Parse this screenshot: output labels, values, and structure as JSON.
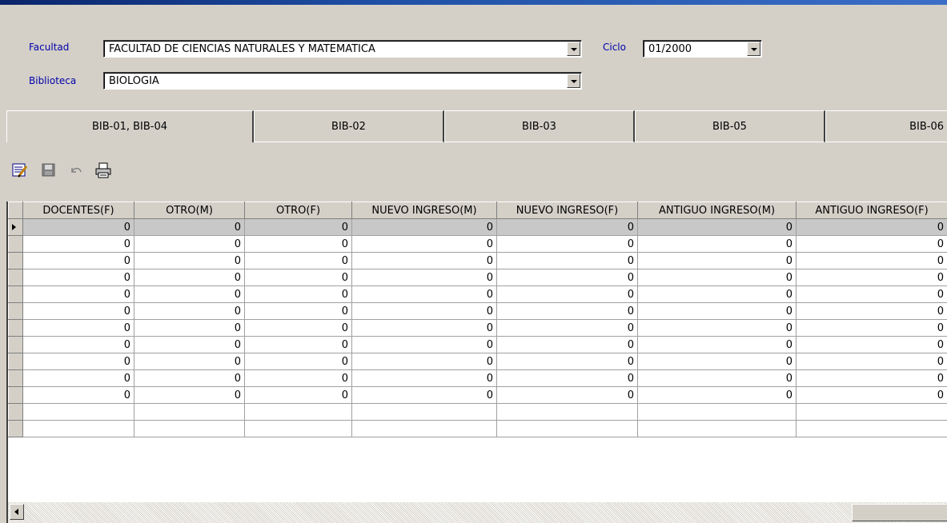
{
  "filters": {
    "facultad_label": "Facultad",
    "facultad_value": "FACULTAD DE CIENCIAS  NATURALES  Y MATEMATICA",
    "biblioteca_label": "Biblioteca",
    "biblioteca_value": "BIOLOGIA",
    "ciclo_label": "Ciclo",
    "ciclo_value": "01/2000"
  },
  "tabs": [
    {
      "label": "BIB-01, BIB-04",
      "active": true
    },
    {
      "label": "BIB-02",
      "active": false
    },
    {
      "label": "BIB-03",
      "active": false
    },
    {
      "label": "BIB-05",
      "active": false
    },
    {
      "label": "BIB-06",
      "active": false
    }
  ],
  "toolbar": {
    "icons": [
      "edit-icon",
      "save-icon",
      "undo-icon",
      "print-icon"
    ]
  },
  "grid": {
    "columns": [
      "DOCENTES(F)",
      "OTRO(M)",
      "OTRO(F)",
      "NUEVO INGRESO(M)",
      "NUEVO INGRESO(F)",
      "ANTIGUO INGRESO(M)",
      "ANTIGUO INGRESO(F)"
    ],
    "rows": [
      [
        "0",
        "0",
        "0",
        "0",
        "0",
        "0",
        "0"
      ],
      [
        "0",
        "0",
        "0",
        "0",
        "0",
        "0",
        "0"
      ],
      [
        "0",
        "0",
        "0",
        "0",
        "0",
        "0",
        "0"
      ],
      [
        "0",
        "0",
        "0",
        "0",
        "0",
        "0",
        "0"
      ],
      [
        "0",
        "0",
        "0",
        "0",
        "0",
        "0",
        "0"
      ],
      [
        "0",
        "0",
        "0",
        "0",
        "0",
        "0",
        "0"
      ],
      [
        "0",
        "0",
        "0",
        "0",
        "0",
        "0",
        "0"
      ],
      [
        "0",
        "0",
        "0",
        "0",
        "0",
        "0",
        "0"
      ],
      [
        "0",
        "0",
        "0",
        "0",
        "0",
        "0",
        "0"
      ],
      [
        "0",
        "0",
        "0",
        "0",
        "0",
        "0",
        "0"
      ],
      [
        "0",
        "0",
        "0",
        "0",
        "0",
        "0",
        "0"
      ],
      [
        "",
        "",
        "",
        "",
        "",
        "",
        ""
      ],
      [
        "",
        "",
        "",
        "",
        "",
        "",
        ""
      ]
    ],
    "selected_row": 0
  }
}
